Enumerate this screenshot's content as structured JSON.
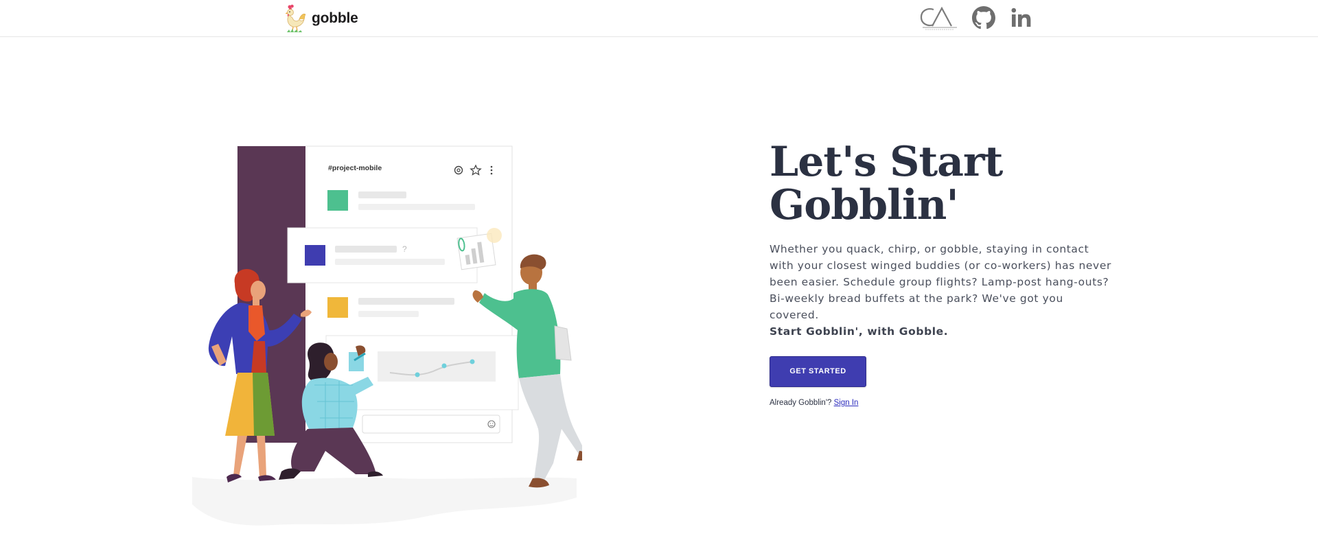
{
  "header": {
    "brand": {
      "name": "gobble",
      "logo_icon": "chicken-logo-icon"
    },
    "links": [
      {
        "icon": "portfolio-ca-logo-icon"
      },
      {
        "icon": "github-icon"
      },
      {
        "icon": "linkedin-icon"
      }
    ]
  },
  "illustration": {
    "channel_name": "#project-mobile",
    "question_mark": "?",
    "icons": [
      "at-sign-icon",
      "star-icon",
      "more-vertical-icon",
      "smiley-icon"
    ]
  },
  "hero": {
    "title_line1": "Let's Start",
    "title_line2": "Gobblin'",
    "body": "Whether you quack, chirp, or gobble, staying in contact with your closest winged buddies (or co-workers) has never been easier. Schedule group flights? Lamp-post hang-outs? Bi-weekly bread buffets at the park? We've got you covered.",
    "body_strong": "Start Gobblin', with Gobble.",
    "cta_label": "Get Started",
    "signin_prompt": "Already Gobblin'?",
    "signin_link": "Sign In"
  },
  "colors": {
    "accent": "#3f3db0",
    "title": "#2b3142",
    "sidebar_purple": "#5a3754",
    "green": "#4dc08f",
    "indigo": "#3f3db0",
    "amber": "#f0b73a"
  }
}
